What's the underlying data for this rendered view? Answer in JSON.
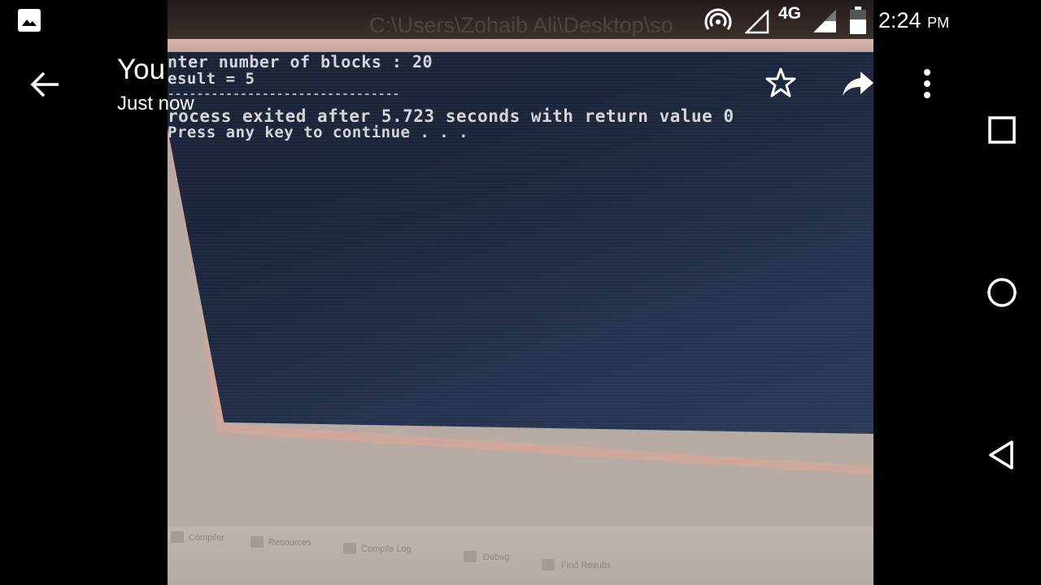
{
  "status_bar": {
    "network_label": "4G",
    "time": "2:24",
    "ampm": "PM",
    "icons": [
      "gallery-icon",
      "hotspot-icon",
      "no-signal-icon",
      "signal-icon",
      "battery-icon"
    ]
  },
  "viewer": {
    "sender": "You",
    "timestamp": "Just now",
    "actions": [
      "back-arrow-icon",
      "star-icon",
      "share-icon",
      "more-vert-icon"
    ]
  },
  "photo": {
    "window_title": "C:\\Users\\Zohaib Ali\\Desktop\\so",
    "console_lines": [
      "nter number of blocks : 20",
      "esult = 5",
      "--------------------------------",
      "rocess exited after 5.723 seconds with return value 0",
      "Press any key to continue . . ."
    ],
    "taskbar": [
      "Compiler",
      "Resources",
      "Compile Log",
      "Debug",
      "Find Results"
    ]
  },
  "nav_bar": {
    "buttons": [
      "recents-square-icon",
      "home-circle-icon",
      "back-triangle-icon"
    ]
  }
}
